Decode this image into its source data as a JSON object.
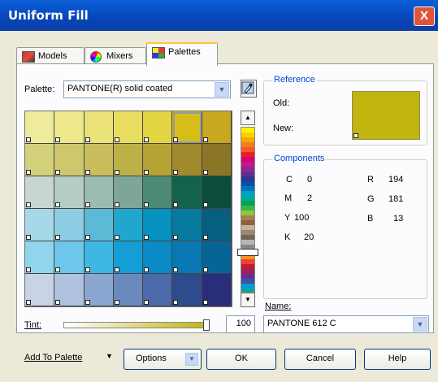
{
  "window": {
    "title": "Uniform Fill",
    "close_label": "X"
  },
  "tabs": [
    {
      "label": "Models",
      "active": false
    },
    {
      "label": "Mixers",
      "active": false
    },
    {
      "label": "Palettes",
      "active": true
    }
  ],
  "palette": {
    "label": "Palette:",
    "selected": "PANTONE(R) solid coated",
    "selected_cell": {
      "row": 0,
      "col": 5
    },
    "swatches": [
      [
        "#eeeb9b",
        "#eee88a",
        "#ebe27a",
        "#e9de62",
        "#e4d542",
        "#d7bd1a",
        "#c7a820"
      ],
      [
        "#d4d17d",
        "#cfc76d",
        "#c8be5e",
        "#bcb049",
        "#b6a336",
        "#9f8a2d",
        "#8b7526"
      ],
      [
        "#c7d7cf",
        "#b5cdc4",
        "#9cbcb1",
        "#7da697",
        "#4c8a74",
        "#13634c",
        "#0a4d3a"
      ],
      [
        "#a7d8e8",
        "#8ccde3",
        "#5bbbd7",
        "#21a6ce",
        "#0691be",
        "#077aa0",
        "#075f7f"
      ],
      [
        "#90d5ec",
        "#6cc7ea",
        "#3fb7e3",
        "#159ed6",
        "#0a8bc8",
        "#0978b3",
        "#076496"
      ],
      [
        "#c8d4e6",
        "#afc3e0",
        "#8ba6d0",
        "#6a89bd",
        "#4b6aa7",
        "#2e4b8c",
        "#2a2e7a"
      ]
    ],
    "strip_colors": [
      "#fff200",
      "#f7d100",
      "#f6a800",
      "#f37b20",
      "#f05a28",
      "#ed1c24",
      "#d6006f",
      "#c2178e",
      "#92278f",
      "#662d91",
      "#2e3192",
      "#0054a6",
      "#0072bc",
      "#00a0c6",
      "#00a99d",
      "#00a651",
      "#39b54a",
      "#8dc63f",
      "#a87c4f",
      "#8c6239",
      "#c7b299",
      "#998675",
      "#736357",
      "#b7b7b7",
      "#898989",
      "#ffd100",
      "#f7941d",
      "#ef4136",
      "#be1e2d",
      "#9e1f63",
      "#662d91",
      "#3954a4",
      "#009bd1",
      "#00a79d",
      "#8dc63f",
      "#d7df23"
    ]
  },
  "reference": {
    "title": "Reference",
    "old_label": "Old:",
    "new_label": "New:",
    "color": "#c2b50d"
  },
  "components": {
    "title": "Components",
    "cmyk": [
      {
        "label": "C",
        "value": "0"
      },
      {
        "label": "M",
        "value": "2"
      },
      {
        "label": "Y",
        "value": "100"
      },
      {
        "label": "K",
        "value": "20"
      }
    ],
    "rgb": [
      {
        "label": "R",
        "value": "194"
      },
      {
        "label": "G",
        "value": "181"
      },
      {
        "label": "B",
        "value": "13"
      }
    ]
  },
  "name_field": {
    "label": "Name:",
    "value": "PANTONE 612 C"
  },
  "tint": {
    "label": "Tint:",
    "value": "100",
    "level_percent": 100
  },
  "buttons": {
    "add_to_palette": "Add To Palette",
    "options": "Options",
    "ok": "OK",
    "cancel": "Cancel",
    "help": "Help"
  },
  "icons": {
    "eyedropper": "eyedropper-icon",
    "scroll_up": "scroll-up-arrow-icon",
    "scroll_down": "scroll-down-arrow-icon"
  }
}
